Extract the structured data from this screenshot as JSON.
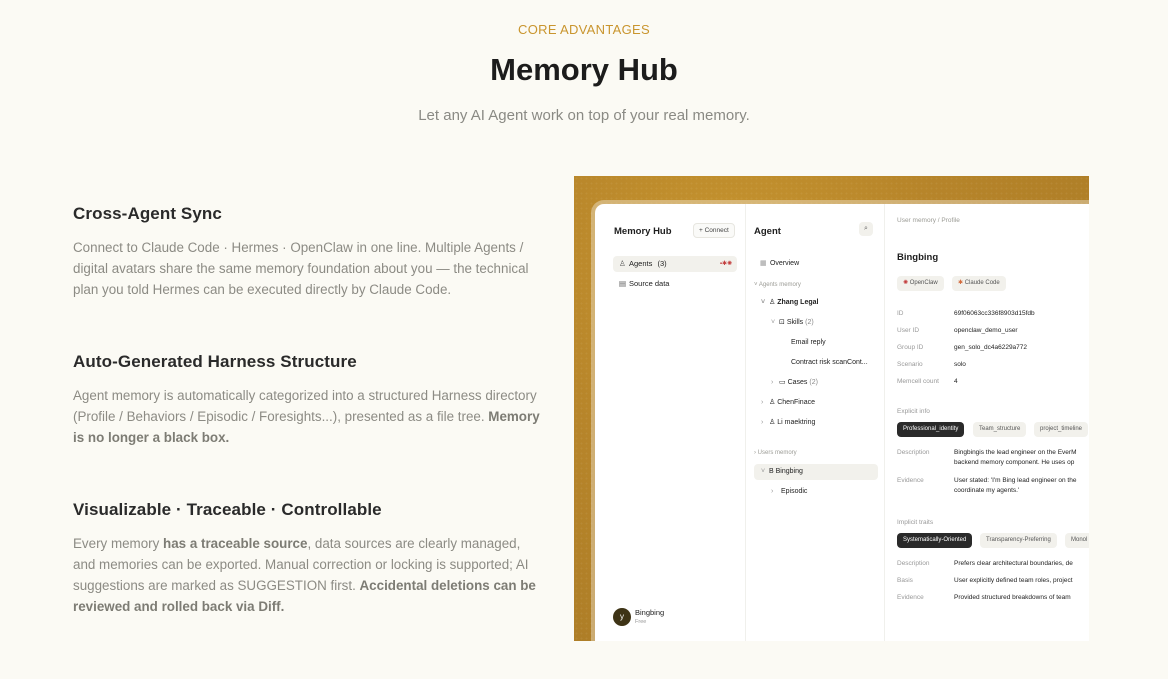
{
  "header": {
    "eyebrow": "CORE ADVANTAGES",
    "title": "Memory Hub",
    "subtitle": "Let any AI Agent work on top of your real memory."
  },
  "features": [
    {
      "title": "Cross-Agent Sync",
      "text": "Connect to Claude Code · Hermes · OpenClaw in one line. Multiple Agents / digital avatars share the same memory foundation about you — the technical plan you told Hermes can be executed directly by Claude Code."
    },
    {
      "title": "Auto-Generated Harness Structure",
      "text_pre": "Agent memory is automatically categorized into a structured Harness directory (Profile / Behaviors / Episodic / Foresights...), presented as a file tree. ",
      "text_bold": "Memory is no longer a black box."
    },
    {
      "title": "Visualizable · Traceable · Controllable",
      "text_a": "Every memory ",
      "text_b": "has a traceable source",
      "text_c": ", data sources are clearly managed, and memories can be exported. Manual correction or locking is supported; AI suggestions are marked as SUGGESTION first. ",
      "text_d": "Accidental deletions can be reviewed and rolled back via Diff."
    }
  ],
  "app": {
    "sidebar": {
      "title": "Memory Hub",
      "connect_label": "Connect",
      "items": [
        {
          "label": "Agents",
          "count": "(3)"
        },
        {
          "label": "Source data"
        }
      ],
      "user_initial": "y",
      "user_name": "Bingbing",
      "user_plan": "Free"
    },
    "agent": {
      "title": "Agent",
      "overview": "Overview",
      "agents_section": "Agents memory",
      "zhang": "Zhang Legal",
      "skills": "Skills",
      "skills_count": "(2)",
      "email_reply": "Email reply",
      "contract": "Contract risk scanCont...",
      "cases": "Cases",
      "cases_count": "(2)",
      "chen": "ChenFinace",
      "li": "Li maektring",
      "users_section": "Users memory",
      "bingbing": "Bingbing",
      "episodic": "Episodic"
    },
    "profile": {
      "breadcrumb": "User memory / Profile",
      "name": "Bingbing",
      "tags": [
        "OpenClaw",
        "Claude Code"
      ],
      "fields": [
        {
          "key": "ID",
          "value": "69f06063cc336f8903d15fdb"
        },
        {
          "key": "User ID",
          "value": "openclaw_demo_user"
        },
        {
          "key": "Group ID",
          "value": "gen_solo_dc4a6229a772"
        },
        {
          "key": "Scenario",
          "value": "solo"
        },
        {
          "key": "Memcell count",
          "value": "4"
        }
      ],
      "explicit_label": "Explicit info",
      "explicit_tabs": [
        "Professional_identity",
        "Team_structure",
        "project_timeline"
      ],
      "explicit_desc_key": "Description",
      "explicit_desc_1": "Bingbingis the lead engineer on the EverM",
      "explicit_desc_2": "backend memory component. He uses op",
      "explicit_evid_key": "Evidence",
      "explicit_evid_1": "User stated: 'I'm Bing lead engineer on the",
      "explicit_evid_2": "coordinate my agents.'",
      "implicit_label": "Implicit traits",
      "implicit_tabs": [
        "Systematically-Oriented",
        "Transparency-Preferring",
        "Monol"
      ],
      "implicit_fields": [
        {
          "key": "Description",
          "value": "Prefers clear architectural boundaries, de"
        },
        {
          "key": "Basis",
          "value": "User explicitly defined team roles, project"
        },
        {
          "key": "Evidence",
          "value": "Provided structured breakdowns of team"
        }
      ]
    }
  }
}
